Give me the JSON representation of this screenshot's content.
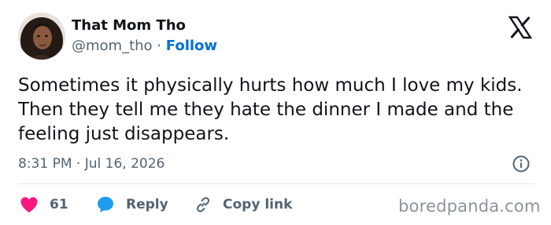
{
  "author": {
    "name": "That Mom Tho",
    "handle": "@mom_tho",
    "separator": "·",
    "follow_label": "Follow"
  },
  "tweet": {
    "text": "Sometimes it physically hurts how much I love my kids. Then they tell me they hate the dinner I made and the feeling just disappears.",
    "timestamp": "8:31 PM · Jul 16, 2026"
  },
  "actions": {
    "like_count": "61",
    "reply_label": "Reply",
    "copy_label": "Copy link"
  },
  "icons": {
    "platform": "x-logo-icon",
    "like": "heart-icon",
    "reply": "speech-bubble-icon",
    "copy": "link-icon",
    "info": "info-icon"
  },
  "colors": {
    "like": "#f91880",
    "reply": "#1d9bf0",
    "follow": "#006fd6",
    "secondary_text": "#536471"
  },
  "watermark": "boredpanda.com"
}
